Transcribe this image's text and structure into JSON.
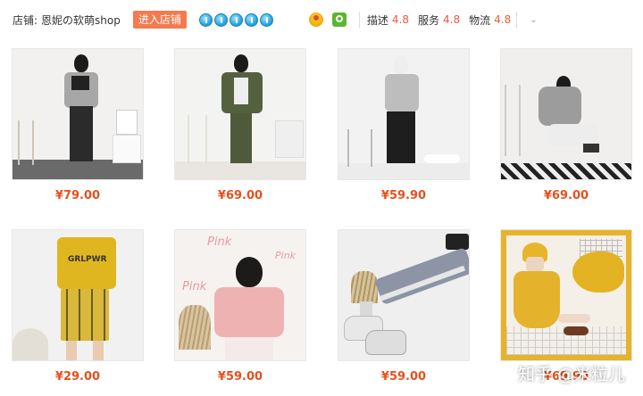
{
  "shop": {
    "label": "店铺:",
    "name": "恩妮の软萌shop",
    "enter_button": "进入店铺",
    "crown_icons": [
      "crown-icon",
      "crown-icon",
      "crown-icon",
      "crown-icon",
      "crown-icon"
    ],
    "ratings": [
      {
        "label": "描述",
        "value": "4.8"
      },
      {
        "label": "服务",
        "value": "4.8"
      },
      {
        "label": "物流",
        "value": "4.8"
      }
    ],
    "accent_color": "#f47a4f",
    "price_color": "#e5511d"
  },
  "products": [
    {
      "price": "¥79.00",
      "scene": "gray-hoodie-black-pants"
    },
    {
      "price": "¥69.00",
      "scene": "olive-jacket-pants"
    },
    {
      "price": "¥59.90",
      "scene": "gray-sweatshirt-wide-pants"
    },
    {
      "price": "¥69.00",
      "scene": "gray-hoodie-sitting"
    },
    {
      "price": "¥29.00",
      "scene": "yellow-tee-plaid-skirt"
    },
    {
      "price": "¥59.00",
      "scene": "pink-shirt-pink-text"
    },
    {
      "price": "¥59.00",
      "scene": "gray-joggers-sneakers"
    },
    {
      "price": "¥69.90",
      "scene": "yellow-polo-sitting"
    }
  ],
  "pink_text": "Pink",
  "tee_text": "GRLPWR",
  "watermark": "知乎 @米粒儿"
}
